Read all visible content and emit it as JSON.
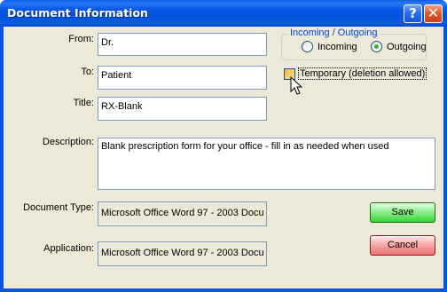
{
  "window": {
    "title": "Document Information"
  },
  "titlebar_buttons": {
    "help_glyph": "?",
    "close_glyph": "✕"
  },
  "form": {
    "from_label": "From:",
    "from_value": "Dr.",
    "to_label": "To:",
    "to_value": "Patient",
    "title_label": "Title:",
    "title_value": "RX-Blank",
    "description_label": "Description:",
    "description_value": "Blank prescription form for your office - fill in as needed when used",
    "document_type_label": "Document Type:",
    "document_type_value": "Microsoft Office Word 97 - 2003 Docu",
    "application_label": "Application:",
    "application_value": "Microsoft Office Word 97 - 2003 Docu"
  },
  "direction": {
    "legend": "Incoming / Outgoing",
    "incoming_label": "Incoming",
    "outgoing_label": "Outgoing",
    "selected": "Outgoing"
  },
  "temporary": {
    "label": "Temporary (deletion allowed)",
    "checked": false
  },
  "buttons": {
    "save_label": "Save",
    "cancel_label": "Cancel"
  },
  "colors": {
    "titlebar": "#0a54e3",
    "dialog_background": "#ece9d8",
    "group_legend": "#0046d5",
    "save_button": "#39d339",
    "cancel_button": "#e87272"
  },
  "icons": {
    "help": "help-icon",
    "close": "close-icon",
    "cursor": "mouse-pointer-icon"
  }
}
